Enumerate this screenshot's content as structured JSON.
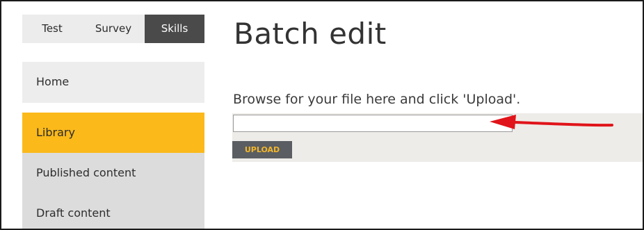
{
  "tabs": [
    {
      "label": "Test"
    },
    {
      "label": "Survey"
    },
    {
      "label": "Skills",
      "active": true
    }
  ],
  "sidebar": {
    "items": [
      {
        "label": "Home"
      },
      {
        "label": "Library",
        "active": true
      },
      {
        "label": "Published content"
      },
      {
        "label": "Draft content"
      }
    ]
  },
  "main": {
    "title": "Batch edit",
    "instructions": "Browse for your file here and click 'Upload'.",
    "file_input_value": "",
    "upload_label": "UPLOAD"
  },
  "colors": {
    "accent": "#fbb91a",
    "tab_active": "#4a4a4a",
    "button_bg": "#5a5e62",
    "button_text": "#f3b62b",
    "annotation_arrow": "#e0141a"
  }
}
